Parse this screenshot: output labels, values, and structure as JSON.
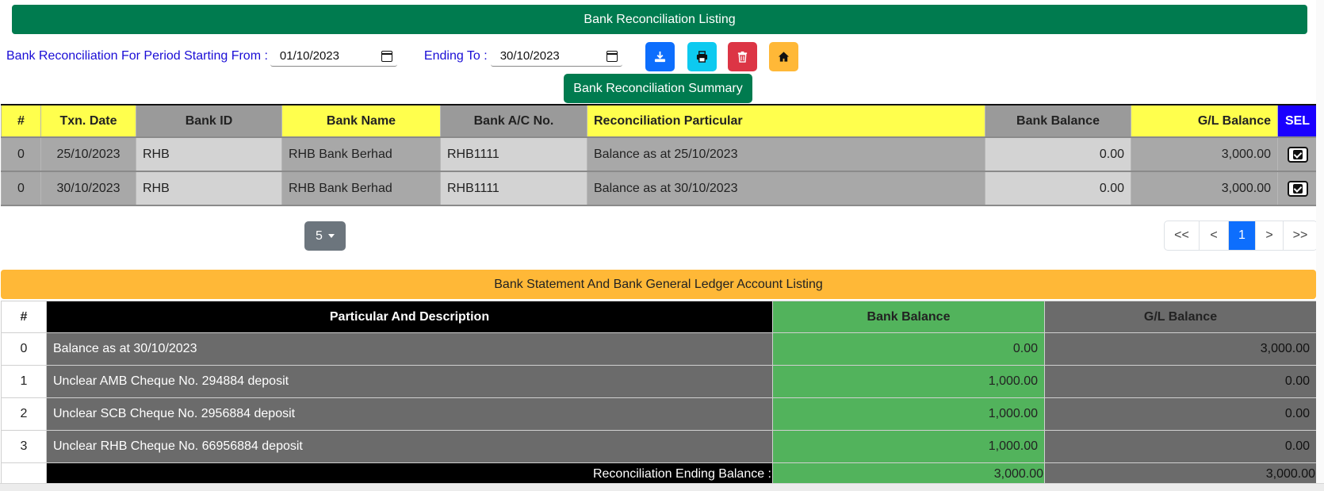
{
  "header": {
    "title": "Bank Reconciliation Listing"
  },
  "period": {
    "start_label": "Bank Reconciliation For Period Starting From :",
    "start_value": "01/10/2023",
    "end_label": "Ending To :",
    "end_value": "30/10/2023"
  },
  "toolbar": {
    "buttons": [
      {
        "name": "download",
        "icon": "download-icon",
        "color": "#0d6efd"
      },
      {
        "name": "print",
        "icon": "print-icon",
        "color": "#0dcaf0"
      },
      {
        "name": "delete",
        "icon": "trash-icon",
        "color": "#dc3545"
      },
      {
        "name": "home",
        "icon": "home-icon",
        "color": "#ffb837"
      }
    ]
  },
  "summary_button": "Bank Reconciliation Summary",
  "recon_table": {
    "headers": [
      "#",
      "Txn. Date",
      "Bank ID",
      "Bank Name",
      "Bank A/C No.",
      "Reconciliation Particular",
      "Bank Balance",
      "G/L Balance",
      "SEL"
    ],
    "rows": [
      {
        "no": "0",
        "date": "25/10/2023",
        "bank_id": "RHB",
        "bank_name": "RHB Bank Berhad",
        "account": "RHB1111",
        "particular": "Balance as at 25/10/2023",
        "bank_balance": "0.00",
        "gl_balance": "3,000.00",
        "selected": true
      },
      {
        "no": "0",
        "date": "30/10/2023",
        "bank_id": "RHB",
        "bank_name": "RHB Bank Berhad",
        "account": "RHB1111",
        "particular": "Balance as at 30/10/2023",
        "bank_balance": "0.00",
        "gl_balance": "3,000.00",
        "selected": true
      }
    ]
  },
  "pagination": {
    "page_size": "5",
    "first": "<<",
    "prev": "<",
    "current": "1",
    "next": ">",
    "last": ">>"
  },
  "ledger": {
    "title": "Bank Statement And Bank General Ledger Account Listing",
    "headers": [
      "#",
      "Particular And Description",
      "Bank Balance",
      "G/L Balance"
    ],
    "rows": [
      {
        "no": "0",
        "desc": "Balance as at 30/10/2023",
        "bank": "0.00",
        "gl": "3,000.00"
      },
      {
        "no": "1",
        "desc": "Unclear AMB Cheque No. 294884 deposit",
        "bank": "1,000.00",
        "gl": "0.00"
      },
      {
        "no": "2",
        "desc": "Unclear SCB Cheque No. 2956884 deposit",
        "bank": "1,000.00",
        "gl": "0.00"
      },
      {
        "no": "3",
        "desc": "Unclear RHB Cheque No. 66956884 deposit",
        "bank": "1,000.00",
        "gl": "0.00"
      }
    ],
    "total_label": "Reconciliation Ending Balance :",
    "total_bank": "3,000.00",
    "total_gl": "3,000.00"
  }
}
